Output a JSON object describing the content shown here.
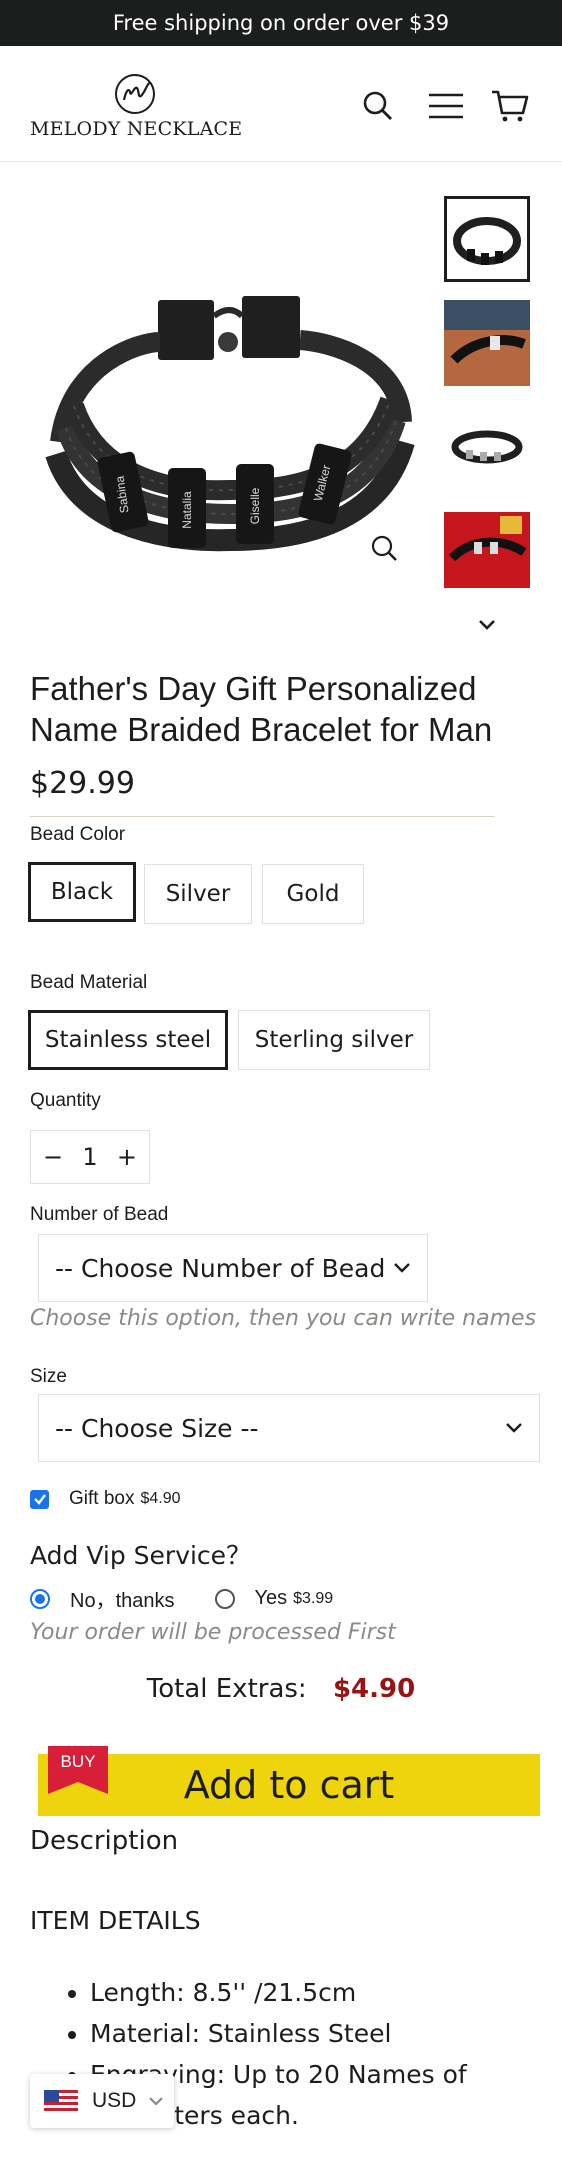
{
  "announcement": "Free shipping on order over $39",
  "brand": {
    "name": "MELODY NECKLACE"
  },
  "product": {
    "title": "Father's Day Gift Personalized Name Braided Bracelet for Man",
    "price": "$29.99",
    "bead_names": [
      "Sabina",
      "Natalia",
      "Giselle",
      "Walker"
    ]
  },
  "options": {
    "bead_color": {
      "label": "Bead Color",
      "values": [
        "Black",
        "Silver",
        "Gold"
      ],
      "selected": "Black"
    },
    "bead_material": {
      "label": "Bead Material",
      "values": [
        "Stainless steel",
        "Sterling silver"
      ],
      "selected": "Stainless steel"
    },
    "quantity": {
      "label": "Quantity",
      "minus": "−",
      "value": "1",
      "plus": "+"
    },
    "number_of_bead": {
      "label": "Number of Bead",
      "value": "-- Choose Number of Bead --",
      "hint": "Choose this option, then you can write names"
    },
    "size": {
      "label": "Size",
      "value": "-- Choose Size --"
    },
    "gift_box": {
      "label": "Gift box",
      "price": "$4.90",
      "checked": true
    },
    "vip": {
      "title": "Add Vip Service？",
      "no_label": "No，thanks",
      "yes_label": "Yes",
      "yes_price": "$3.99",
      "selected": "no",
      "hint": "Your order will be processed First"
    }
  },
  "extras": {
    "label": "Total Extras:",
    "value": "$4.90"
  },
  "cart": {
    "badge": "BUY",
    "button": "Add to cart"
  },
  "description": {
    "title": "Description",
    "subtitle": "ITEM DETAILS",
    "items": [
      "Length: 8.5'' /21.5cm",
      "Material:  Stainless Steel",
      "Engraving: Up to 20 Names of",
      "   characters each."
    ]
  },
  "currency": {
    "code": "USD"
  },
  "colors": {
    "accent_yellow": "#eed40c",
    "price_red": "#9b1212",
    "buy_red": "#d71f3a",
    "dark": "#1c1d1d"
  },
  "icons": [
    "search-icon",
    "menu-icon",
    "cart-icon",
    "zoom-icon",
    "chevron-down-icon",
    "us-flag-icon"
  ]
}
